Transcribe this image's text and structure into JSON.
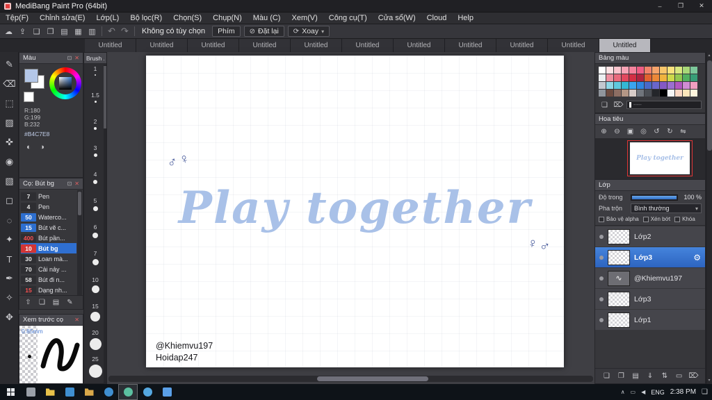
{
  "titlebar": {
    "title": "MediBang Paint Pro (64bit)",
    "minimize": "–",
    "maximize": "❐",
    "close": "✕"
  },
  "menubar": {
    "items": [
      "Tệp(F)",
      "Chỉnh sửa(E)",
      "Lớp(L)",
      "Bộ lọc(R)",
      "Chọn(S)",
      "Chụp(N)",
      "Màu (C)",
      "Xem(V)",
      "Công cụ(T)",
      "Cửa sổ(W)",
      "Cloud",
      "Help"
    ]
  },
  "toolbar": {
    "icons": [
      {
        "name": "cloud-icon",
        "glyph": "☁"
      },
      {
        "name": "save-icon",
        "glyph": "⇪"
      },
      {
        "name": "comment-icon",
        "glyph": "❑"
      },
      {
        "name": "chat-icon",
        "glyph": "❒"
      },
      {
        "name": "document-icon",
        "glyph": "▤"
      },
      {
        "name": "grid-icon",
        "glyph": "▦"
      },
      {
        "name": "panel-layout-icon",
        "glyph": "▥"
      }
    ],
    "undo_glyph": "↶",
    "redo_glyph": "↷",
    "no_option_label": "Không có tùy chọn",
    "key_button": "Phím",
    "reset_icon": "⊘",
    "reset_label": "Đặt lại",
    "rotate_icon": "⟳",
    "rotate_label": "Xoay",
    "rotate_caret": "▾"
  },
  "tabs": [
    {
      "label": "Untitled"
    },
    {
      "label": "Untitled"
    },
    {
      "label": "Untitled"
    },
    {
      "label": "Untitled"
    },
    {
      "label": "Untitled"
    },
    {
      "label": "Untitled"
    },
    {
      "label": "Untitled"
    },
    {
      "label": "Untitled"
    },
    {
      "label": "Untitled"
    },
    {
      "label": "Untitled"
    },
    {
      "label": "Untitled",
      "active": true
    }
  ],
  "tools": [
    {
      "name": "pen-tool-icon",
      "glyph": "✎"
    },
    {
      "name": "eraser-tool-icon",
      "glyph": "⌫"
    },
    {
      "name": "marquee-tool-icon",
      "glyph": "⬚"
    },
    {
      "name": "pattern-tool-icon",
      "glyph": "▨"
    },
    {
      "name": "move-tool-icon",
      "glyph": "✜"
    },
    {
      "name": "fill-tool-icon",
      "glyph": "◉"
    },
    {
      "name": "gradient-tool-icon",
      "glyph": "▧"
    },
    {
      "name": "select-tool-icon",
      "glyph": "◻"
    },
    {
      "name": "lasso-tool-icon",
      "glyph": "◌"
    },
    {
      "name": "magic-wand-tool-icon",
      "glyph": "✦"
    },
    {
      "name": "text-tool-icon",
      "glyph": "T"
    },
    {
      "name": "curve-tool-icon",
      "glyph": "✒"
    },
    {
      "name": "eyedropper-tool-icon",
      "glyph": "✧"
    },
    {
      "name": "hand-tool-icon",
      "glyph": "✥"
    }
  ],
  "color_panel": {
    "title": "Màu",
    "fg_color": "#b4c7e8",
    "r": "R:180",
    "g": "G:199",
    "b": "B:232",
    "hex": "#B4C7E8"
  },
  "brush_panel": {
    "title": "Cọ: Bút bg",
    "brushes": [
      {
        "size": "7",
        "name": "Pen",
        "num_bg": "#2e2e32",
        "num_color": "#e8e8e8"
      },
      {
        "size": "4",
        "name": "Pen",
        "num_bg": "#2e2e32",
        "num_color": "#e8e8e8"
      },
      {
        "size": "50",
        "name": "Waterco...",
        "num_bg": "#2d6fd0",
        "num_color": "#ffffff"
      },
      {
        "size": "15",
        "name": "Bút vẽ c...",
        "num_bg": "#2d6fd0",
        "num_color": "#ffffff"
      },
      {
        "size": "400",
        "name": "Bút pần...",
        "num_bg": "#2e2e32",
        "num_color": "#ff5050"
      },
      {
        "size": "10",
        "name": "Bút bg",
        "num_bg": "#d23535",
        "num_color": "#ffffff",
        "selected": true
      },
      {
        "size": "30",
        "name": "Loan mà...",
        "num_bg": "#2e2e32",
        "num_color": "#e8e8e8"
      },
      {
        "size": "70",
        "name": "Cải nảy ...",
        "num_bg": "#2e2e32",
        "num_color": "#e8e8e8"
      },
      {
        "size": "58",
        "name": "Bút đi n...",
        "num_bg": "#2e2e32",
        "num_color": "#e8e8e8"
      },
      {
        "size": "15",
        "name": "Dạng nh...",
        "num_bg": "#2e2e32",
        "num_color": "#ff5050"
      }
    ]
  },
  "brush_toolbar": [
    {
      "name": "add-brush-icon",
      "glyph": "⇧"
    },
    {
      "name": "new-brush-icon",
      "glyph": "❏"
    },
    {
      "name": "brush-folder-icon",
      "glyph": "▤"
    },
    {
      "name": "edit-brush-icon",
      "glyph": "✎"
    }
  ],
  "preview_panel": {
    "title": "Xem trước cọ",
    "size_label": "0.85mm"
  },
  "size_panel": {
    "header": "Brush ...",
    "sizes": [
      {
        "label": "1",
        "dot": "2px"
      },
      {
        "label": "1.5",
        "dot": "3px"
      },
      {
        "label": "2",
        "dot": "4px"
      },
      {
        "label": "3",
        "dot": "5px"
      },
      {
        "label": "4",
        "dot": "6px"
      },
      {
        "label": "5",
        "dot": "7px"
      },
      {
        "label": "6",
        "dot": "8px"
      },
      {
        "label": "7",
        "dot": "9px"
      },
      {
        "label": "10",
        "dot": "11px"
      },
      {
        "label": "15",
        "dot": "14px"
      },
      {
        "label": "20",
        "dot": "17px"
      },
      {
        "label": "25",
        "dot": "19px"
      }
    ]
  },
  "canvas": {
    "title_text": "Play together",
    "text_color": "#a9c1e8",
    "symbols_topleft": "♂♀",
    "symbols_bottomright": "♀♂",
    "credit_line1": "@Khiemvu197",
    "credit_line2": "Hoidap247"
  },
  "palette_panel": {
    "title": "Bảng màu",
    "strip_text": "-----",
    "colors": [
      "#ffffff",
      "#fde2e4",
      "#fbc4cd",
      "#f8a3b5",
      "#f5839d",
      "#ef5d84",
      "#f2846b",
      "#f6a46b",
      "#f8c66b",
      "#f9e27d",
      "#d9e87f",
      "#a8d878",
      "#7cc79a",
      "#eceff1",
      "#ef8f9f",
      "#e96a7d",
      "#e2485e",
      "#d32f45",
      "#b02440",
      "#e2622f",
      "#ec8838",
      "#f0b33e",
      "#ccd94a",
      "#93c84f",
      "#52b060",
      "#379e77",
      "#c3c8cf",
      "#8fd7e6",
      "#5fc8de",
      "#35b7d4",
      "#3aa4ef",
      "#2f86e0",
      "#4a69c8",
      "#6a66cc",
      "#8459c4",
      "#9b6fd0",
      "#b257c0",
      "#d08cd4",
      "#ef9fc0",
      "#90959c",
      "#6d4c41",
      "#8d6e63",
      "#b39685",
      "#d7ccc8",
      "#70757c",
      "#4a4e54",
      "#24262a",
      "#000000",
      "#f5f5f5",
      "#fcd8c4",
      "#fde6bb",
      "#fff4dd"
    ]
  },
  "navigator_panel": {
    "title": "Hoa tiêu",
    "thumb_text": "Play together",
    "icons": [
      {
        "name": "zoom-in-icon",
        "glyph": "⊕"
      },
      {
        "name": "zoom-out-icon",
        "glyph": "⊖"
      },
      {
        "name": "zoom-fit-icon",
        "glyph": "▣"
      },
      {
        "name": "zoom-actual-icon",
        "glyph": "◎"
      },
      {
        "name": "rotate-left-icon",
        "glyph": "↺"
      },
      {
        "name": "rotate-right-icon",
        "glyph": "↻"
      },
      {
        "name": "flip-icon",
        "glyph": "⇋"
      }
    ]
  },
  "layers_panel": {
    "title": "Lớp",
    "opacity_label": "Độ trong",
    "opacity_value": "100 %",
    "blend_label": "Pha trộn",
    "blend_value": "Bình thường",
    "blend_caret": "▾",
    "alpha_lock_label": "Bảo vệ alpha",
    "clip_label": "Xén bớt",
    "lock_label": "Khóa",
    "gear_glyph": "⚙",
    "layers": [
      {
        "name": "Lớp2"
      },
      {
        "name": "Lớp3",
        "selected": true
      },
      {
        "name": "@Khiemvu197"
      },
      {
        "name": "Lớp3"
      },
      {
        "name": "Lớp1"
      }
    ],
    "footer_icons": [
      {
        "name": "new-layer-icon",
        "glyph": "❏"
      },
      {
        "name": "duplicate-layer-icon",
        "glyph": "❐"
      },
      {
        "name": "layer-folder-icon",
        "glyph": "▤"
      },
      {
        "name": "merge-down-icon",
        "glyph": "⇓"
      },
      {
        "name": "transfer-layer-icon",
        "glyph": "⇅"
      },
      {
        "name": "clear-layer-icon",
        "glyph": "▭"
      },
      {
        "name": "delete-layer-icon",
        "glyph": "⌦"
      }
    ]
  },
  "taskbar": {
    "lang": "ENG",
    "time": "2:38 PM",
    "apps": [
      {
        "name": "task-view-icon",
        "color": "#9aa0a8",
        "shape": "square"
      },
      {
        "name": "file-explorer-icon",
        "color": "#e8c24a",
        "shape": "folder"
      },
      {
        "name": "store-icon",
        "color": "#3f8fd0",
        "shape": "square"
      },
      {
        "name": "documents-folder-icon",
        "color": "#d8a84a",
        "shape": "folder"
      },
      {
        "name": "edge-icon",
        "color": "#3f8fd0",
        "shape": "circle"
      },
      {
        "name": "medibang-taskbar-icon",
        "color": "#5bc0a0",
        "shape": "circle",
        "active": true
      },
      {
        "name": "skype-icon",
        "color": "#55a8e0",
        "shape": "circle"
      },
      {
        "name": "photos-icon",
        "color": "#5aa0e8",
        "shape": "square"
      }
    ]
  }
}
